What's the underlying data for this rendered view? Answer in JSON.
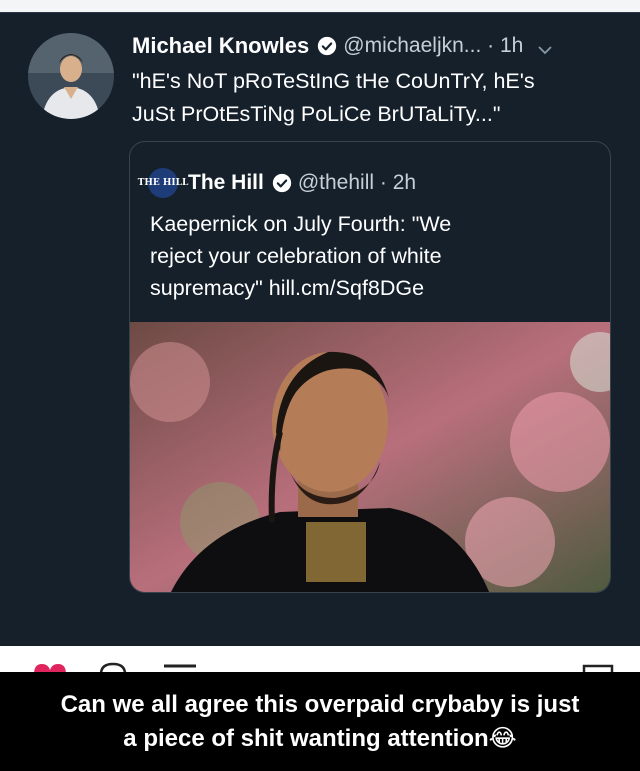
{
  "tweet": {
    "author_name": "Michael Knowles",
    "handle_time": "@michaeljkn... · 1h",
    "text_line1": "\"hE's NoT pRoTeStInG tHe CoUnTrY, hE's",
    "text_line2": "JuSt PrOtEsTiNg PoLiCe BrUTaLiTy...\"",
    "icons": {
      "verified": "verified-badge-icon",
      "more": "chevron-down-icon"
    }
  },
  "quoted_tweet": {
    "logo_text": "THE HILL",
    "author_name": "The Hill",
    "handle_time": "@thehill · 2h",
    "text_line1": "Kaepernick on July Fourth: \"We",
    "text_line2": "reject your celebration of white",
    "text_line3": "supremacy\" hill.cm/Sqf8DGe"
  },
  "caption": {
    "line1": "Can we all agree this overpaid crybaby is just",
    "line2": "a piece of shit wanting attention😂"
  },
  "colors": {
    "background": "#15202b",
    "card_border": "#38444d",
    "verified": "#ffffff",
    "caption_bg": "#000000",
    "text": "#ffffff"
  }
}
